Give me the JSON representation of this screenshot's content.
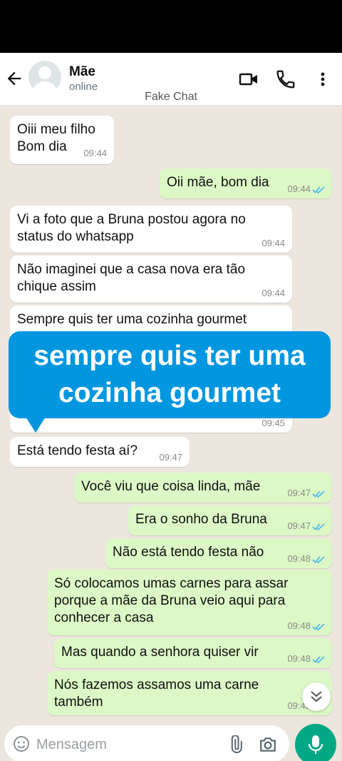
{
  "header": {
    "contact_name": "Mãe",
    "status": "online",
    "banner": "Fake Chat",
    "icons": [
      "back-arrow-icon",
      "video-call-icon",
      "phone-icon",
      "more-vertical-icon"
    ]
  },
  "messages": [
    {
      "dir": "in",
      "text": "Oiii meu filho\nBom dia",
      "time": "09:44"
    },
    {
      "dir": "out",
      "text": "Oii mãe, bom dia",
      "time": "09:44",
      "read": true
    },
    {
      "dir": "in",
      "text": "Vi a foto que a Bruna postou agora no\nstatus do whatsapp",
      "time": "09:44"
    },
    {
      "dir": "in",
      "text": "Não imaginei que a casa nova era tão\nchique assim",
      "time": "09:44"
    },
    {
      "dir": "in",
      "text": "Sempre quis ter uma cozinha gourmet",
      "time": "09:45"
    },
    {
      "dir": "in",
      "text": "Está tendo festa aí?",
      "time": "09:47"
    },
    {
      "dir": "out",
      "text": "Você viu que coisa linda, mãe",
      "time": "09:47",
      "read": true
    },
    {
      "dir": "out",
      "text": "Era o sonho da Bruna",
      "time": "09:47",
      "read": true
    },
    {
      "dir": "out",
      "text": "Não está tendo festa não",
      "time": "09:48",
      "read": true
    },
    {
      "dir": "out",
      "text": "Só colocamos umas carnes para assar\nporque a mãe da Bruna veio aqui para\nconhecer a casa",
      "time": "09:48",
      "read": true
    },
    {
      "dir": "out",
      "text": "Mas quando a senhora quiser vir",
      "time": "09:48",
      "read": true
    },
    {
      "dir": "out",
      "text": "Nós fazemos assamos uma carne\ntambém",
      "time": "09:48",
      "read": true
    }
  ],
  "overlay_caption": "sempre quis ter uma\ncozinha gourmet",
  "composer": {
    "placeholder": "Mensagem",
    "icons": [
      "emoji-icon",
      "attach-icon",
      "camera-icon",
      "mic-icon"
    ]
  },
  "colors": {
    "incoming": "#ffffff",
    "outgoing": "#dcf8c6",
    "chat_bg": "#ece6de",
    "read_ticks": "#53bdeb",
    "overlay": "#0096e0",
    "mic_button": "#00a884"
  }
}
